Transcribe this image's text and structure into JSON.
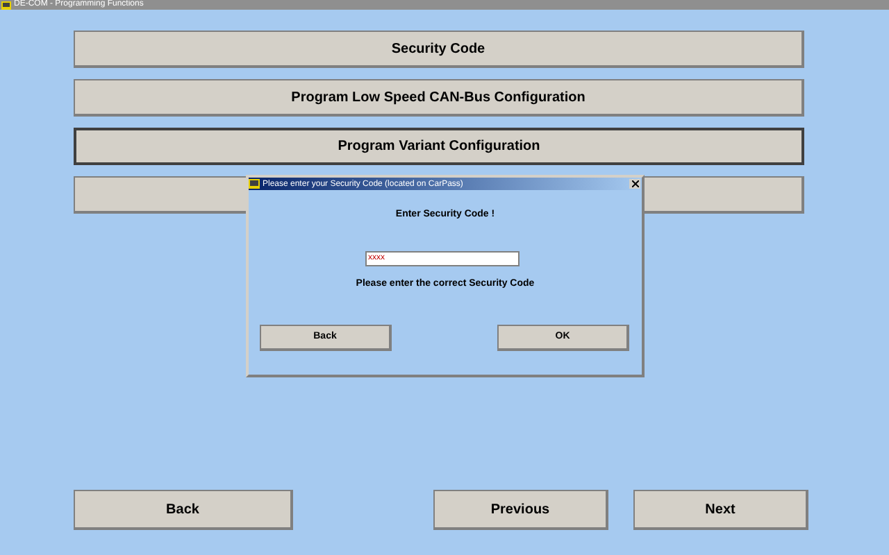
{
  "window": {
    "title": "DE-COM - Programming Functions"
  },
  "menu_buttons": [
    {
      "label": "Security Code",
      "focused": false
    },
    {
      "label": "Program Low Speed CAN-Bus Configuration",
      "focused": false
    },
    {
      "label": "Program Variant Configuration",
      "focused": true
    },
    {
      "focused": false
    }
  ],
  "dialog": {
    "title": "Please enter your Security Code (located on CarPass)",
    "heading": "Enter Security Code !",
    "code_field": {
      "value": "xxxx"
    },
    "message": "Please enter the correct Security Code",
    "buttons": [
      "Back",
      "OK"
    ]
  },
  "nav_buttons": [
    "Back",
    "Previous",
    "Next"
  ]
}
